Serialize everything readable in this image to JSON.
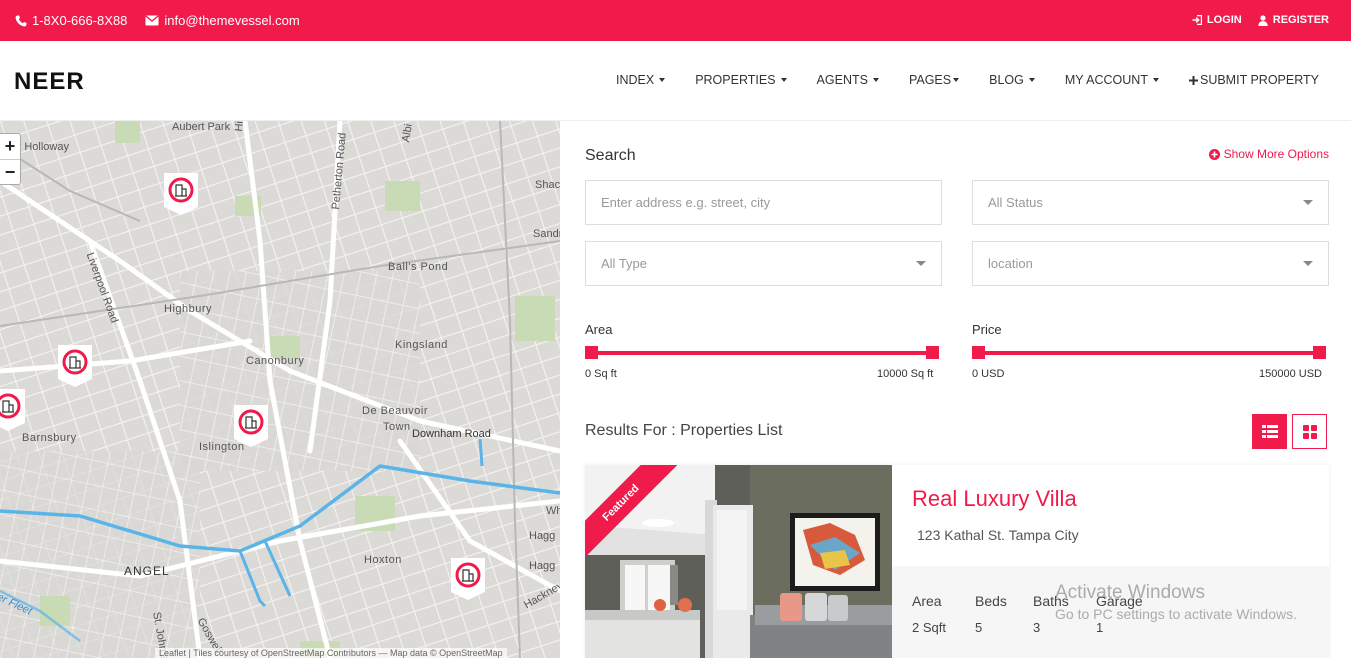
{
  "topbar": {
    "phone": "1-8X0-666-8X88",
    "email": "info@themevessel.com",
    "login_label": "LOGIN",
    "register_label": "REGISTER"
  },
  "brand": {
    "logo": "NEER",
    "accent_color": "#f01a4b"
  },
  "nav": {
    "items": [
      {
        "label": "INDEX"
      },
      {
        "label": "PROPERTIES"
      },
      {
        "label": "AGENTS"
      },
      {
        "label": "PAGES"
      },
      {
        "label": "BLOG"
      },
      {
        "label": "MY ACCOUNT"
      },
      {
        "label": "SUBMIT PROPERTY"
      }
    ]
  },
  "map": {
    "zoom_in": "+",
    "zoom_out": "−",
    "labels": {
      "aubert_park": "Aubert Park",
      "holloway": "ver Holloway",
      "highbury_road": "Highbu",
      "petherton": "Petherton Road",
      "albion": "Albi",
      "shac": "Shac",
      "sandr": "Sandr",
      "liverpool": "Liverpool Road",
      "balls_pond": "Ball's Pond",
      "highbury": "Highbury",
      "kingsland": "Kingsland",
      "canonbury": "Canonbury",
      "de_beauvoir": "De Beauvoir",
      "town": "Town",
      "downham": "Downham Road",
      "barnsbury": "Barnsbury",
      "islington": "Islington",
      "wh": "Wh",
      "hagg1": "Hagg",
      "hoxton": "Hoxton",
      "angel": "ANGEL",
      "hagg2": "Hagg",
      "hackney": "Hackney",
      "fleet": "er Fleet",
      "st_johns": "St. John's",
      "goswell": "Goswell"
    },
    "attribution": "Leaflet | Tiles courtesy of OpenStreetMap Contributors — Map data © OpenStreetMap"
  },
  "search": {
    "title": "Search",
    "more_options": "Show More Options",
    "address_placeholder": "Enter address e.g. street, city",
    "status_value": "All Status",
    "type_value": "All Type",
    "location_value": "location",
    "area": {
      "label": "Area",
      "min": 0,
      "max": 10000,
      "min_label": "0 Sq ft",
      "max_label": "10000 Sq ft"
    },
    "price": {
      "label": "Price",
      "min": 0,
      "max": 150000,
      "min_label": "0 USD",
      "max_label": "150000 USD"
    }
  },
  "results": {
    "title": "Results For : Properties List",
    "listing": {
      "badge": "Featured",
      "title": "Real Luxury Villa",
      "address": "123 Kathal St. Tampa City",
      "facts": [
        {
          "label": "Area",
          "value": "2 Sqft"
        },
        {
          "label": "Beds",
          "value": "5"
        },
        {
          "label": "Baths",
          "value": "3"
        },
        {
          "label": "Garage",
          "value": "1"
        }
      ]
    }
  },
  "watermark": {
    "line1": "Activate Windows",
    "line2": "Go to PC settings to activate Windows."
  }
}
